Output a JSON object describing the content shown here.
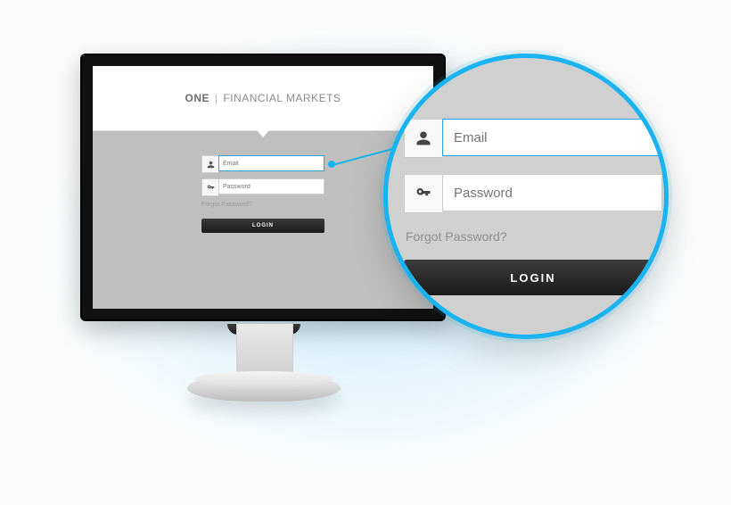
{
  "brand": {
    "bold": "ONE",
    "rest": "FINANCIAL MARKETS"
  },
  "form": {
    "email_placeholder": "Email",
    "password_placeholder": "Password",
    "forgot": "Forgot Password?",
    "login": "LOGIN"
  },
  "colors": {
    "accent": "#18b3f0"
  }
}
